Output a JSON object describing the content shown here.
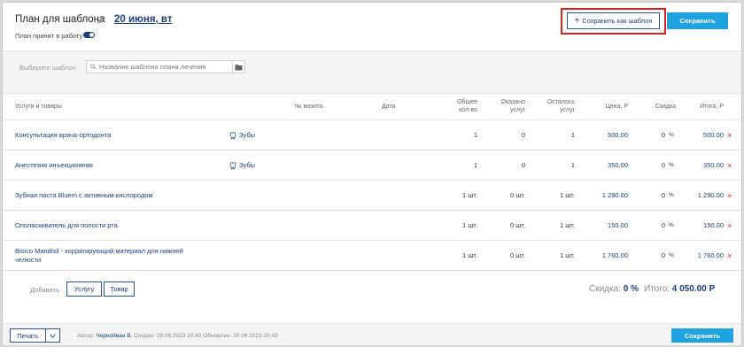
{
  "header": {
    "title": "План для шаблона",
    "date": "20 июня, вт",
    "plan_accepted_label": "План принят в работу",
    "save_as_template_label": "Сохранить как шаблон",
    "save_label": "Сохранить"
  },
  "template_bar": {
    "select_label": "Выберите шаблон",
    "search_placeholder": "Название шаблона плана лечения"
  },
  "table": {
    "columns": {
      "services": "Услуги и товары",
      "visit": "№ визита",
      "date": "Дата",
      "total_qty": "Общее\nкол-во",
      "provided": "Оказано\nуслуг",
      "remaining": "Осталось\nуслуг",
      "price": "Цена, Р",
      "discount": "Скидка",
      "total": "Итого, Р"
    },
    "rows": [
      {
        "name": "Консультация врача-ортодонта",
        "teeth": "Зубы",
        "total_qty": "1",
        "provided": "0",
        "remaining": "1",
        "price": "500.00",
        "discount": "0",
        "discount_unit": "%",
        "total": "500.00"
      },
      {
        "name": "Анестезия инъекционная",
        "teeth": "Зубы",
        "total_qty": "1",
        "provided": "0",
        "remaining": "1",
        "price": "350.00",
        "discount": "0",
        "discount_unit": "%",
        "total": "350.00"
      },
      {
        "name": "Зубная паста Bluem с активным кислородом",
        "teeth": "",
        "total_qty": "1 шт.",
        "provided": "0 шт.",
        "remaining": "1 шт.",
        "price": "1 290.00",
        "discount": "0",
        "discount_unit": "%",
        "total": "1 290.00"
      },
      {
        "name": "Ополаскиватель для полости рта",
        "teeth": "",
        "total_qty": "1 шт.",
        "provided": "0 шт.",
        "remaining": "1 шт.",
        "price": "150.00",
        "discount": "0",
        "discount_unit": "%",
        "total": "150.00"
      },
      {
        "name": "Bisico Mandisil - корригирующий материал для нижней челюсти",
        "teeth": "",
        "total_qty": "1 шт.",
        "provided": "0 шт.",
        "remaining": "1 шт.",
        "price": "1 760.00",
        "discount": "0",
        "discount_unit": "%",
        "total": "1 760.00"
      }
    ],
    "delete_glyph": "×"
  },
  "add_bar": {
    "add_label": "Добавить",
    "service_button": "Услугу",
    "product_button": "Товар",
    "discount_label": "Скидка:",
    "discount_value": "0 %",
    "total_label": "Итого:",
    "total_value": "4 050.00 Р"
  },
  "footer": {
    "print_label": "Печать",
    "author_label": "Автор:",
    "author_name": "Чернойван В.",
    "created_label": "Создан:",
    "created_value": "20.06.2023 20:43",
    "updated_label": "Обновлен:",
    "updated_value": "20.06.2023 20:43",
    "save_label": "Сохранить"
  },
  "colors": {
    "accent": "#1fa3e0",
    "link": "#1a3e7a",
    "danger": "#e02020"
  }
}
